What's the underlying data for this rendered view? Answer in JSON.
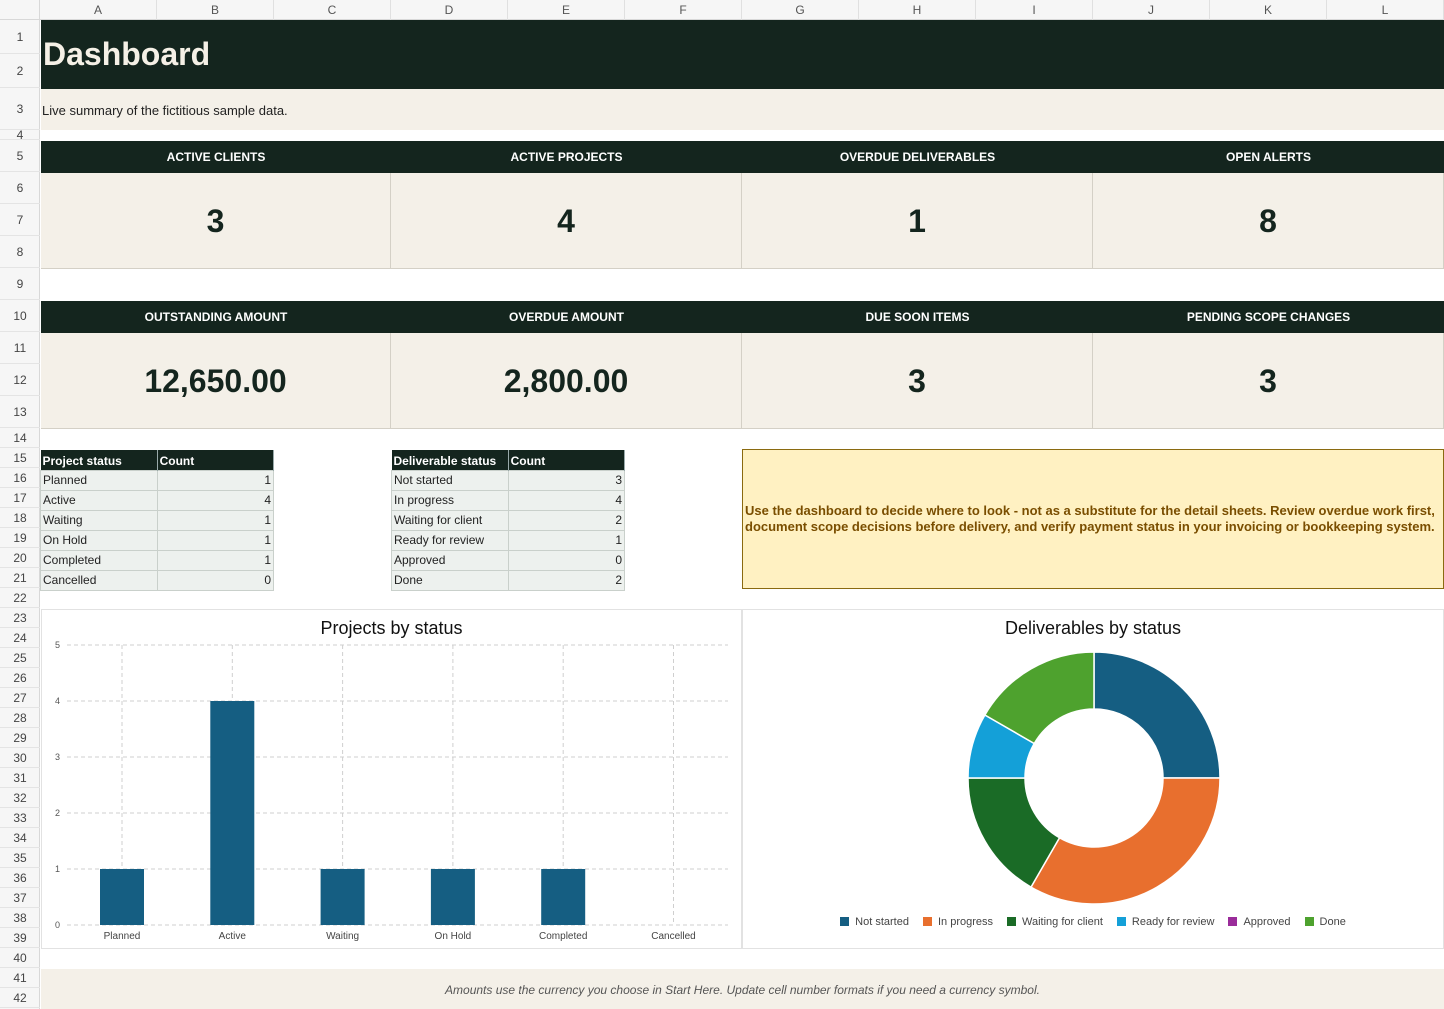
{
  "columns": [
    "A",
    "B",
    "C",
    "D",
    "E",
    "F",
    "G",
    "H",
    "I",
    "J",
    "K",
    "L"
  ],
  "rows": [
    "1",
    "2",
    "3",
    "4",
    "5",
    "6",
    "7",
    "8",
    "9",
    "10",
    "11",
    "12",
    "13",
    "14",
    "15",
    "16",
    "17",
    "18",
    "19",
    "20",
    "21",
    "22",
    "23",
    "24",
    "25",
    "26",
    "27",
    "28",
    "29",
    "30",
    "31",
    "32",
    "33",
    "34",
    "35",
    "36",
    "37",
    "38",
    "39",
    "40",
    "41",
    "42"
  ],
  "title": "Dashboard",
  "subtitle": "Live summary of the fictitious sample data.",
  "kpis_row1": [
    {
      "label": "ACTIVE CLIENTS",
      "value": "3"
    },
    {
      "label": "ACTIVE PROJECTS",
      "value": "4"
    },
    {
      "label": "OVERDUE DELIVERABLES",
      "value": "1"
    },
    {
      "label": "OPEN ALERTS",
      "value": "8"
    }
  ],
  "kpis_row2": [
    {
      "label": "OUTSTANDING AMOUNT",
      "value": "12,650.00"
    },
    {
      "label": "OVERDUE AMOUNT",
      "value": "2,800.00"
    },
    {
      "label": "DUE SOON ITEMS",
      "value": "3"
    },
    {
      "label": "PENDING SCOPE CHANGES",
      "value": "3"
    }
  ],
  "project_table": {
    "headers": [
      "Project status",
      "Count"
    ],
    "rows": [
      [
        "Planned",
        "1"
      ],
      [
        "Active",
        "4"
      ],
      [
        "Waiting",
        "1"
      ],
      [
        "On Hold",
        "1"
      ],
      [
        "Completed",
        "1"
      ],
      [
        "Cancelled",
        "0"
      ]
    ]
  },
  "deliverable_table": {
    "headers": [
      "Deliverable status",
      "Count"
    ],
    "rows": [
      [
        "Not started",
        "3"
      ],
      [
        "In progress",
        "4"
      ],
      [
        "Waiting for client",
        "2"
      ],
      [
        "Ready for review",
        "1"
      ],
      [
        "Approved",
        "0"
      ],
      [
        "Done",
        "2"
      ]
    ]
  },
  "note": "Use the dashboard to decide where to look - not as a substitute for the detail sheets. Review overdue work first, document scope decisions before delivery, and verify payment status in your invoicing or bookkeeping system.",
  "footer": "Amounts use the currency you choose in Start Here. Update cell number formats if you need a currency symbol.",
  "chart_data": [
    {
      "type": "bar",
      "title": "Projects by status",
      "categories": [
        "Planned",
        "Active",
        "Waiting",
        "On Hold",
        "Completed",
        "Cancelled"
      ],
      "values": [
        1,
        4,
        1,
        1,
        1,
        0
      ],
      "ylim": [
        0,
        5
      ],
      "yticks": [
        "0",
        "1",
        "2",
        "3",
        "4",
        "5"
      ],
      "color": "#155e82",
      "grid": true
    },
    {
      "type": "pie",
      "title": "Deliverables by status",
      "labels": [
        "Not started",
        "In progress",
        "Waiting for client",
        "Ready for review",
        "Approved",
        "Done"
      ],
      "values": [
        3,
        4,
        2,
        1,
        0,
        2
      ],
      "colors": [
        "#155e82",
        "#e86f2e",
        "#1a6b26",
        "#14a0d8",
        "#9a2c9a",
        "#4ea22e"
      ],
      "legend": "bottom",
      "donut": true
    }
  ]
}
